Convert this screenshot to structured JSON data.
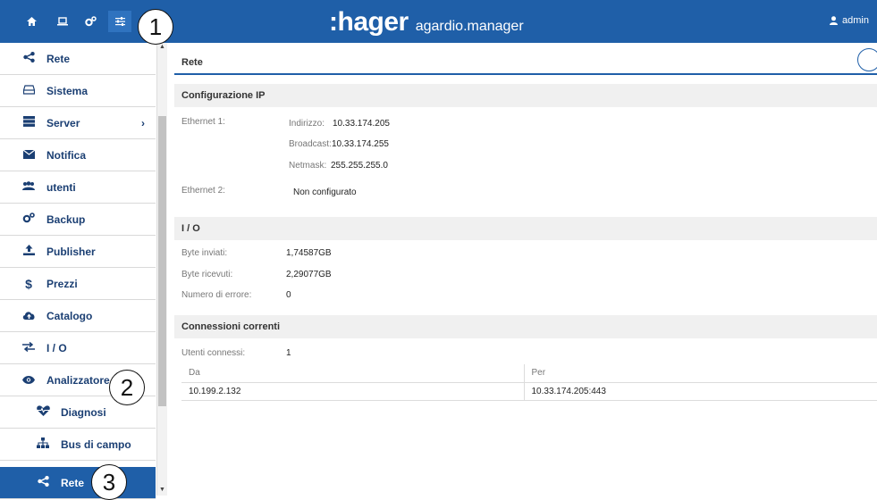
{
  "topbar": {
    "icons": [
      "home-icon",
      "laptop-icon",
      "gears-icon",
      "sliders-icon"
    ],
    "brand": ":hager",
    "product": "agardio.manager",
    "user": "admin"
  },
  "callouts": [
    "1",
    "2",
    "3"
  ],
  "sidebar": {
    "items": [
      {
        "label": "Rete",
        "icon": "share-icon"
      },
      {
        "label": "Sistema",
        "icon": "hdd-icon"
      },
      {
        "label": "Server",
        "icon": "server-icon",
        "chevron": "›"
      },
      {
        "label": "Notifica",
        "icon": "envelope-icon"
      },
      {
        "label": "utenti",
        "icon": "users-icon"
      },
      {
        "label": "Backup",
        "icon": "gears-icon"
      },
      {
        "label": "Publisher",
        "icon": "upload-icon"
      },
      {
        "label": "Prezzi",
        "icon": "dollar-icon"
      },
      {
        "label": "Catalogo",
        "icon": "cloud-upload-icon"
      },
      {
        "label": "I / O",
        "icon": "exchange-icon"
      },
      {
        "label": "Analizzatore",
        "icon": "eye-icon"
      },
      {
        "label": "Diagnosi",
        "icon": "heartbeat-icon"
      },
      {
        "label": "Bus di campo",
        "icon": "sitemap-icon"
      },
      {
        "label": "Rete",
        "icon": "share-icon"
      }
    ]
  },
  "main": {
    "title": "Rete",
    "ip_section": "Configurazione IP",
    "eth1_label": "Ethernet 1:",
    "eth1": {
      "address_label": "Indirizzo:",
      "address": "10.33.174.205",
      "broadcast_label": "Broadcast:",
      "broadcast": "10.33.174.255",
      "netmask_label": "Netmask:",
      "netmask": "255.255.255.0"
    },
    "eth2_label": "Ethernet 2:",
    "eth2_value": "Non configurato",
    "io_section": "I / O",
    "bytes_sent_label": "Byte inviati:",
    "bytes_sent": "1,74587GB",
    "bytes_recv_label": "Byte ricevuti:",
    "bytes_recv": "2,29077GB",
    "errors_label": "Numero di errore:",
    "errors": "0",
    "conn_section": "Connessioni correnti",
    "users_label": "Utenti connessi:",
    "users": "1",
    "table": {
      "headers": [
        "Da",
        "Per"
      ],
      "rows": [
        [
          "10.199.2.132",
          "10.33.174.205:443"
        ]
      ]
    }
  }
}
